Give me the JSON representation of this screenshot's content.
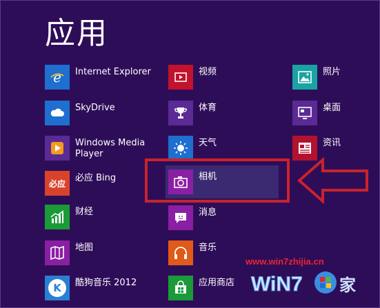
{
  "header": {
    "title": "应用"
  },
  "columns": [
    {
      "items": [
        {
          "label": "Internet Explorer",
          "icon": "internet-explorer-icon",
          "tile_color": "#1e6fcf"
        },
        {
          "label": "SkyDrive",
          "icon": "cloud-icon",
          "tile_color": "#1e6fcf"
        },
        {
          "label": "Windows Media\nPlayer",
          "icon": "media-player-icon",
          "tile_color": "#5b2a95"
        },
        {
          "label": "必应 Bing",
          "icon": "bing-icon",
          "tile_color": "#d9432b",
          "tile_text": "必应"
        },
        {
          "label": "财经",
          "icon": "finance-chart-icon",
          "tile_color": "#1b9a38"
        },
        {
          "label": "地图",
          "icon": "map-icon",
          "tile_color": "#8b1fa3"
        },
        {
          "label": "酷狗音乐 2012",
          "icon": "kugou-music-icon",
          "tile_color": "#2a7fd4",
          "tile_text": "K"
        }
      ]
    },
    {
      "items": [
        {
          "label": "视频",
          "icon": "video-icon",
          "tile_color": "#c1122e"
        },
        {
          "label": "体育",
          "icon": "trophy-icon",
          "tile_color": "#5b2a95"
        },
        {
          "label": "天气",
          "icon": "sun-icon",
          "tile_color": "#1e6fcf"
        },
        {
          "label": "相机",
          "icon": "camera-icon",
          "tile_color": "#8b1fa3"
        },
        {
          "label": "消息",
          "icon": "message-icon",
          "tile_color": "#8b1fa3"
        },
        {
          "label": "音乐",
          "icon": "headphones-icon",
          "tile_color": "#e05a1a"
        },
        {
          "label": "应用商店",
          "icon": "store-icon",
          "tile_color": "#1b9a38"
        }
      ]
    },
    {
      "items": [
        {
          "label": "照片",
          "icon": "photo-icon",
          "tile_color": "#1aa3a3"
        },
        {
          "label": "桌面",
          "icon": "desktop-icon",
          "tile_color": "#5b2a95"
        },
        {
          "label": "资讯",
          "icon": "news-icon",
          "tile_color": "#b3122e"
        }
      ]
    }
  ],
  "watermark": {
    "url": "www.win7zhijia.cn",
    "logo_text": "WiN7之家"
  },
  "colors": {
    "background": "#2e0d58",
    "highlight": "#c8232c"
  }
}
